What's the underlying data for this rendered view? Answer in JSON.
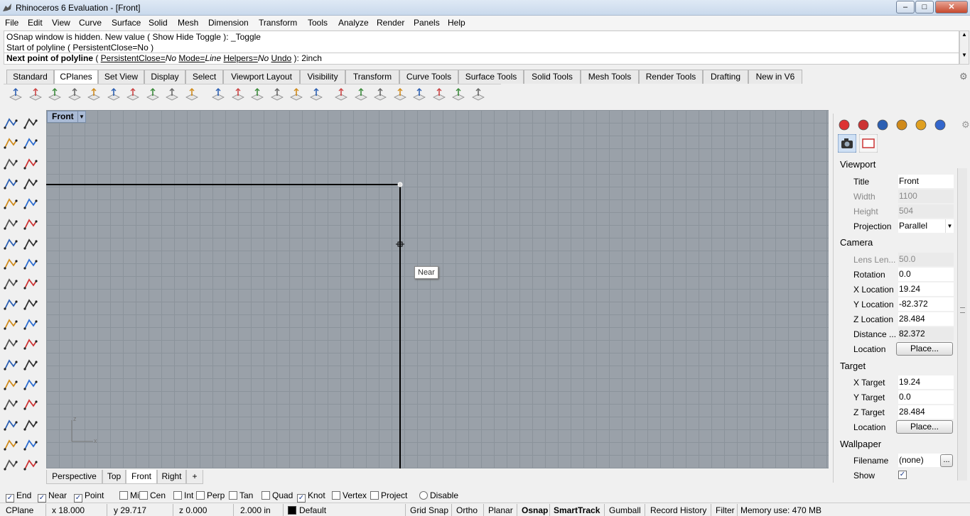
{
  "window": {
    "title": "Rhinoceros 6 Evaluation - [Front]",
    "minimize": "–",
    "maximize": "□",
    "close": "✕"
  },
  "menu": [
    "File",
    "Edit",
    "View",
    "Curve",
    "Surface",
    "Solid",
    "Mesh",
    "Dimension",
    "Transform",
    "Tools",
    "Analyze",
    "Render",
    "Panels",
    "Help"
  ],
  "command": {
    "history": [
      "OSnap window is hidden. New value ( Show  Hide  Toggle ): _Toggle",
      "Start of polyline ( PersistentClose=No )"
    ],
    "prompt_label": "Next point of polyline",
    "prompt_open": " ( ",
    "opt1_name": "PersistentClose=",
    "opt1_val": "No",
    "opt2_name": "Mode=",
    "opt2_val": "Line",
    "opt3_name": "Helpers=",
    "opt3_val": "No",
    "opt4_name": "Undo",
    "prompt_close": " ): ",
    "input": "2inch"
  },
  "toolbar_tabs": [
    "Standard",
    "CPlanes",
    "Set View",
    "Display",
    "Select",
    "Viewport Layout",
    "Visibility",
    "Transform",
    "Curve Tools",
    "Surface Tools",
    "Solid Tools",
    "Mesh Tools",
    "Render Tools",
    "Drafting",
    "New in V6"
  ],
  "active_toolbar_tab": "CPlanes",
  "toolbar_icons": [
    "cplane-world-top-icon",
    "cplane-elevation-icon",
    "cplane-to-object-icon",
    "cplane-to-surface-icon",
    "cplane-rotate-icon",
    "cplane-3point-icon",
    "cplane-xaxis-icon",
    "cplane-zaxis-icon",
    "cplane-perpendicular-icon",
    "cplane-view-icon",
    "undo-cplane-icon",
    "named-cplanes-icon",
    "cplane-grid-icon",
    "save-cplane-icon",
    "open-cplane-icon",
    "cplane-to-view-icon",
    "cplane-front-icon",
    "cplane-right-icon",
    "cplane-back-icon",
    "cplane-left-icon",
    "cplane-bottom-icon",
    "cplane-next-icon",
    "cplane-previous-icon",
    "cplane-box-icon"
  ],
  "left_tools": [
    "select-icon",
    "point-icon",
    "polyline-icon",
    "curve-cp-icon",
    "circle-icon",
    "ellipse-icon",
    "arc-icon",
    "rectangle-icon",
    "polygon-icon",
    "fillet-curves-icon",
    "surface-corner-icon",
    "extrude-curve-icon",
    "box-icon",
    "sphere-icon",
    "cylinder-icon",
    "mesh-plane-icon",
    "explode-icon",
    "trim-icon",
    "split-icon",
    "join-icon",
    "boolean-union-icon",
    "group-icon",
    "fillet-icon",
    "rebuild-icon",
    "text-icon",
    "dimension-icon",
    "array-icon",
    "block-icon",
    "box-edit-icon",
    "layer-icon",
    "array-grid-icon",
    "history-icon",
    "cage-icon",
    "check-icon",
    "render-object-icon",
    "light-icon"
  ],
  "viewport": {
    "label": "Front",
    "tooltip": "Near",
    "axis_x": "x",
    "axis_z": "z",
    "tabs": [
      "Perspective",
      "Top",
      "Front",
      "Right"
    ],
    "active_tab": "Front",
    "add_tab": "+"
  },
  "panel_tabs": [
    "color-wheel-icon",
    "material-icon",
    "sphere-render-icon",
    "pencil-icon",
    "folder-icon",
    "help-panel-icon"
  ],
  "properties": {
    "viewport_heading": "Viewport",
    "title_label": "Title",
    "title_value": "Front",
    "width_label": "Width",
    "width_value": "1100",
    "height_label": "Height",
    "height_value": "504",
    "projection_label": "Projection",
    "projection_value": "Parallel",
    "camera_heading": "Camera",
    "lens_label": "Lens Len...",
    "lens_value": "50.0",
    "rotation_label": "Rotation",
    "rotation_value": "0.0",
    "xloc_label": "X Location",
    "xloc_value": "19.24",
    "yloc_label": "Y Location",
    "yloc_value": "-82.372",
    "zloc_label": "Z Location",
    "zloc_value": "28.484",
    "distance_label": "Distance ...",
    "distance_value": "82.372",
    "location_label": "Location",
    "place_button": "Place...",
    "target_heading": "Target",
    "xtarget_label": "X Target",
    "xtarget_value": "19.24",
    "ytarget_label": "Y Target",
    "ytarget_value": "0.0",
    "ztarget_label": "Z Target",
    "ztarget_value": "28.484",
    "tlocation_label": "Location",
    "tplace_button": "Place...",
    "wallpaper_heading": "Wallpaper",
    "filename_label": "Filename",
    "filename_value": "(none)",
    "browse_button": "...",
    "show_label": "Show"
  },
  "osnap": [
    {
      "label": "End",
      "checked": true
    },
    {
      "label": "Near",
      "checked": true
    },
    {
      "label": "Point",
      "checked": true
    },
    {
      "label": "Mid",
      "checked": false
    },
    {
      "label": "Cen",
      "checked": false
    },
    {
      "label": "Int",
      "checked": false
    },
    {
      "label": "Perp",
      "checked": false
    },
    {
      "label": "Tan",
      "checked": false
    },
    {
      "label": "Quad",
      "checked": false
    },
    {
      "label": "Knot",
      "checked": true
    },
    {
      "label": "Vertex",
      "checked": false
    },
    {
      "label": "Project",
      "checked": false
    },
    {
      "label": "Disable",
      "checked": false
    }
  ],
  "status": {
    "cplane": "CPlane",
    "x": "x 18.000",
    "y": "y 29.717",
    "z": "z 0.000",
    "units": "2.000 in",
    "layer": "Default",
    "layer_color": "#000000",
    "grid_snap": "Grid Snap",
    "ortho": "Ortho",
    "planar": "Planar",
    "osnap": "Osnap",
    "smarttrack": "SmartTrack",
    "gumball": "Gumball",
    "record_history": "Record History",
    "filter": "Filter",
    "memory": "Memory use: 470 MB"
  },
  "colors": {
    "viewport_bg": "#9aa1a9",
    "grid": "#8b939b",
    "curve": "#000000",
    "active_label": "#aabbd6"
  }
}
